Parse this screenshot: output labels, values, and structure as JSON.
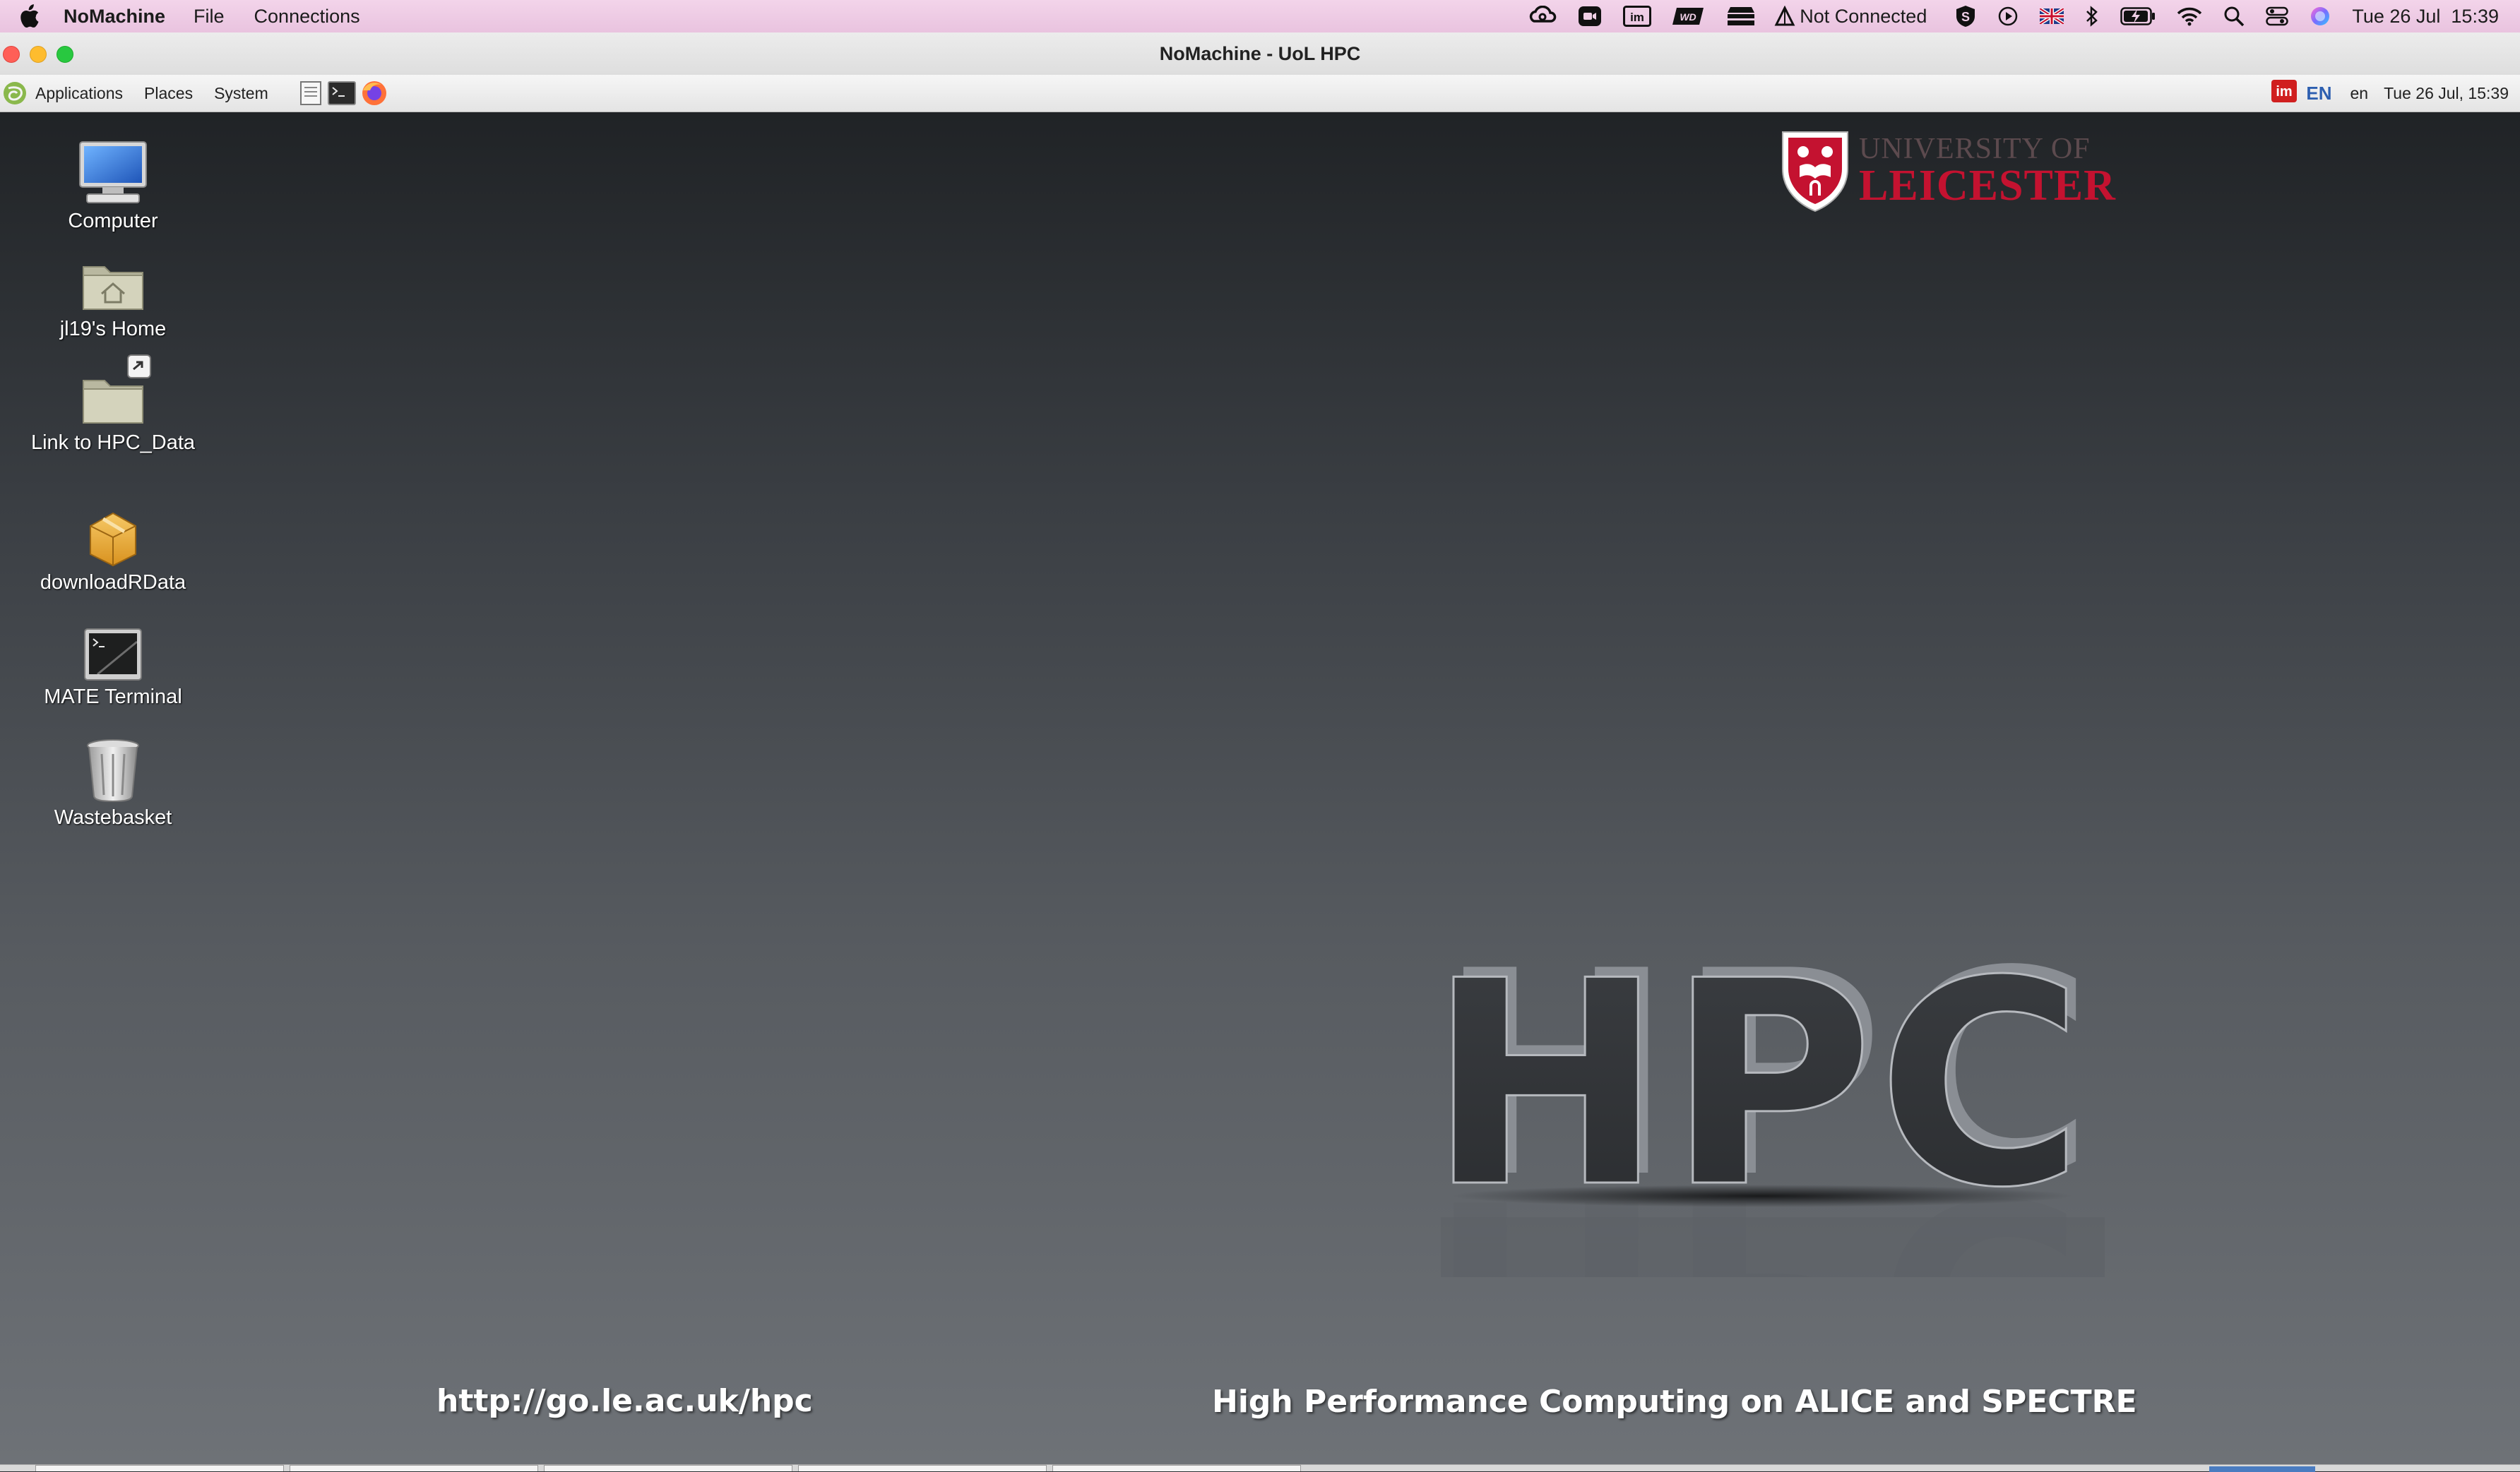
{
  "mac_menubar": {
    "app_name": "NoMachine",
    "menus": [
      "File",
      "Connections"
    ],
    "status_text": "Not Connected",
    "datetime": "Tue 26 Jul  15:39"
  },
  "window": {
    "title": "NoMachine - UoL HPC"
  },
  "panel": {
    "menus": [
      "Applications",
      "Places",
      "System"
    ],
    "keyboard_layout": "EN",
    "locale": "en",
    "datetime": "Tue 26 Jul, 15:39"
  },
  "desktop": {
    "icons": [
      {
        "label": "Computer",
        "icon": "computer-icon"
      },
      {
        "label": "jl19's Home",
        "icon": "home-folder-icon"
      },
      {
        "label": "Link to HPC_Data",
        "icon": "folder-link-icon"
      },
      {
        "label": "downloadRData",
        "icon": "package-icon"
      },
      {
        "label": "MATE Terminal",
        "icon": "terminal-icon"
      },
      {
        "label": "Wastebasket",
        "icon": "trash-icon"
      }
    ],
    "logo": {
      "line1": "UNIVERSITY OF",
      "line2": "LEICESTER"
    },
    "hpc_text": "HPC",
    "url_text": "http://go.le.ac.uk/hpc",
    "tagline": "High Performance Computing on ALICE and SPECTRE"
  },
  "colors": {
    "menubar_bg": "#efcfe6",
    "leicester_red": "#c41230",
    "desktop_top": "#202326",
    "desktop_bottom": "#6e7277"
  }
}
